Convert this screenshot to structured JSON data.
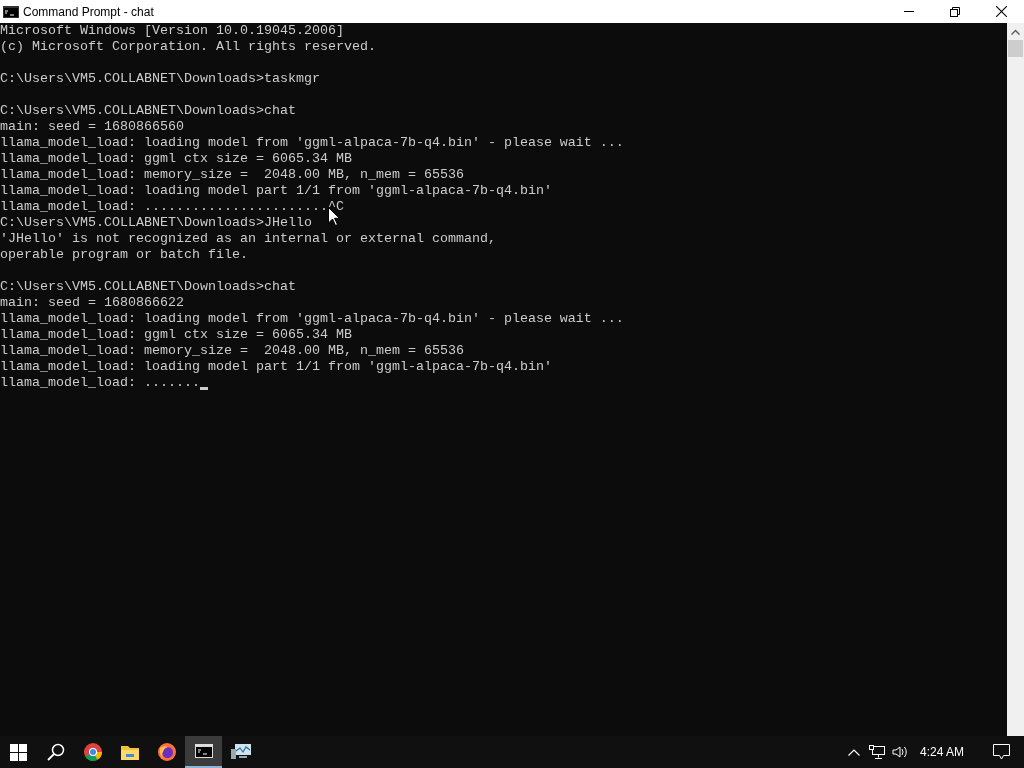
{
  "window": {
    "title": "Command Prompt - chat"
  },
  "console": {
    "blocks": [
      [
        "Microsoft Windows [Version 10.0.19045.2006]",
        "(c) Microsoft Corporation. All rights reserved."
      ],
      [
        "C:\\Users\\VM5.COLLABNET\\Downloads>taskmgr"
      ],
      [
        "C:\\Users\\VM5.COLLABNET\\Downloads>chat",
        "main: seed = 1680866560",
        "llama_model_load: loading model from 'ggml-alpaca-7b-q4.bin' - please wait ...",
        "llama_model_load: ggml ctx size = 6065.34 MB",
        "llama_model_load: memory_size =  2048.00 MB, n_mem = 65536",
        "llama_model_load: loading model part 1/1 from 'ggml-alpaca-7b-q4.bin'",
        "llama_model_load: .......................^C",
        "C:\\Users\\VM5.COLLABNET\\Downloads>JHello",
        "'JHello' is not recognized as an internal or external command,",
        "operable program or batch file."
      ],
      [
        "C:\\Users\\VM5.COLLABNET\\Downloads>chat",
        "main: seed = 1680866622",
        "llama_model_load: loading model from 'ggml-alpaca-7b-q4.bin' - please wait ...",
        "llama_model_load: ggml ctx size = 6065.34 MB",
        "llama_model_load: memory_size =  2048.00 MB, n_mem = 65536",
        "llama_model_load: loading model part 1/1 from 'ggml-alpaca-7b-q4.bin'",
        "llama_model_load: ......."
      ]
    ],
    "cursor_visible": true
  },
  "taskbar": {
    "apps": [
      {
        "kind": "start",
        "selected": false
      },
      {
        "kind": "search",
        "selected": false
      },
      {
        "kind": "chrome",
        "selected": false
      },
      {
        "kind": "folder",
        "selected": false
      },
      {
        "kind": "firefox",
        "selected": false
      },
      {
        "kind": "cmd",
        "selected": true
      },
      {
        "kind": "monitor",
        "selected": false
      }
    ],
    "clock": "4:24 AM"
  }
}
